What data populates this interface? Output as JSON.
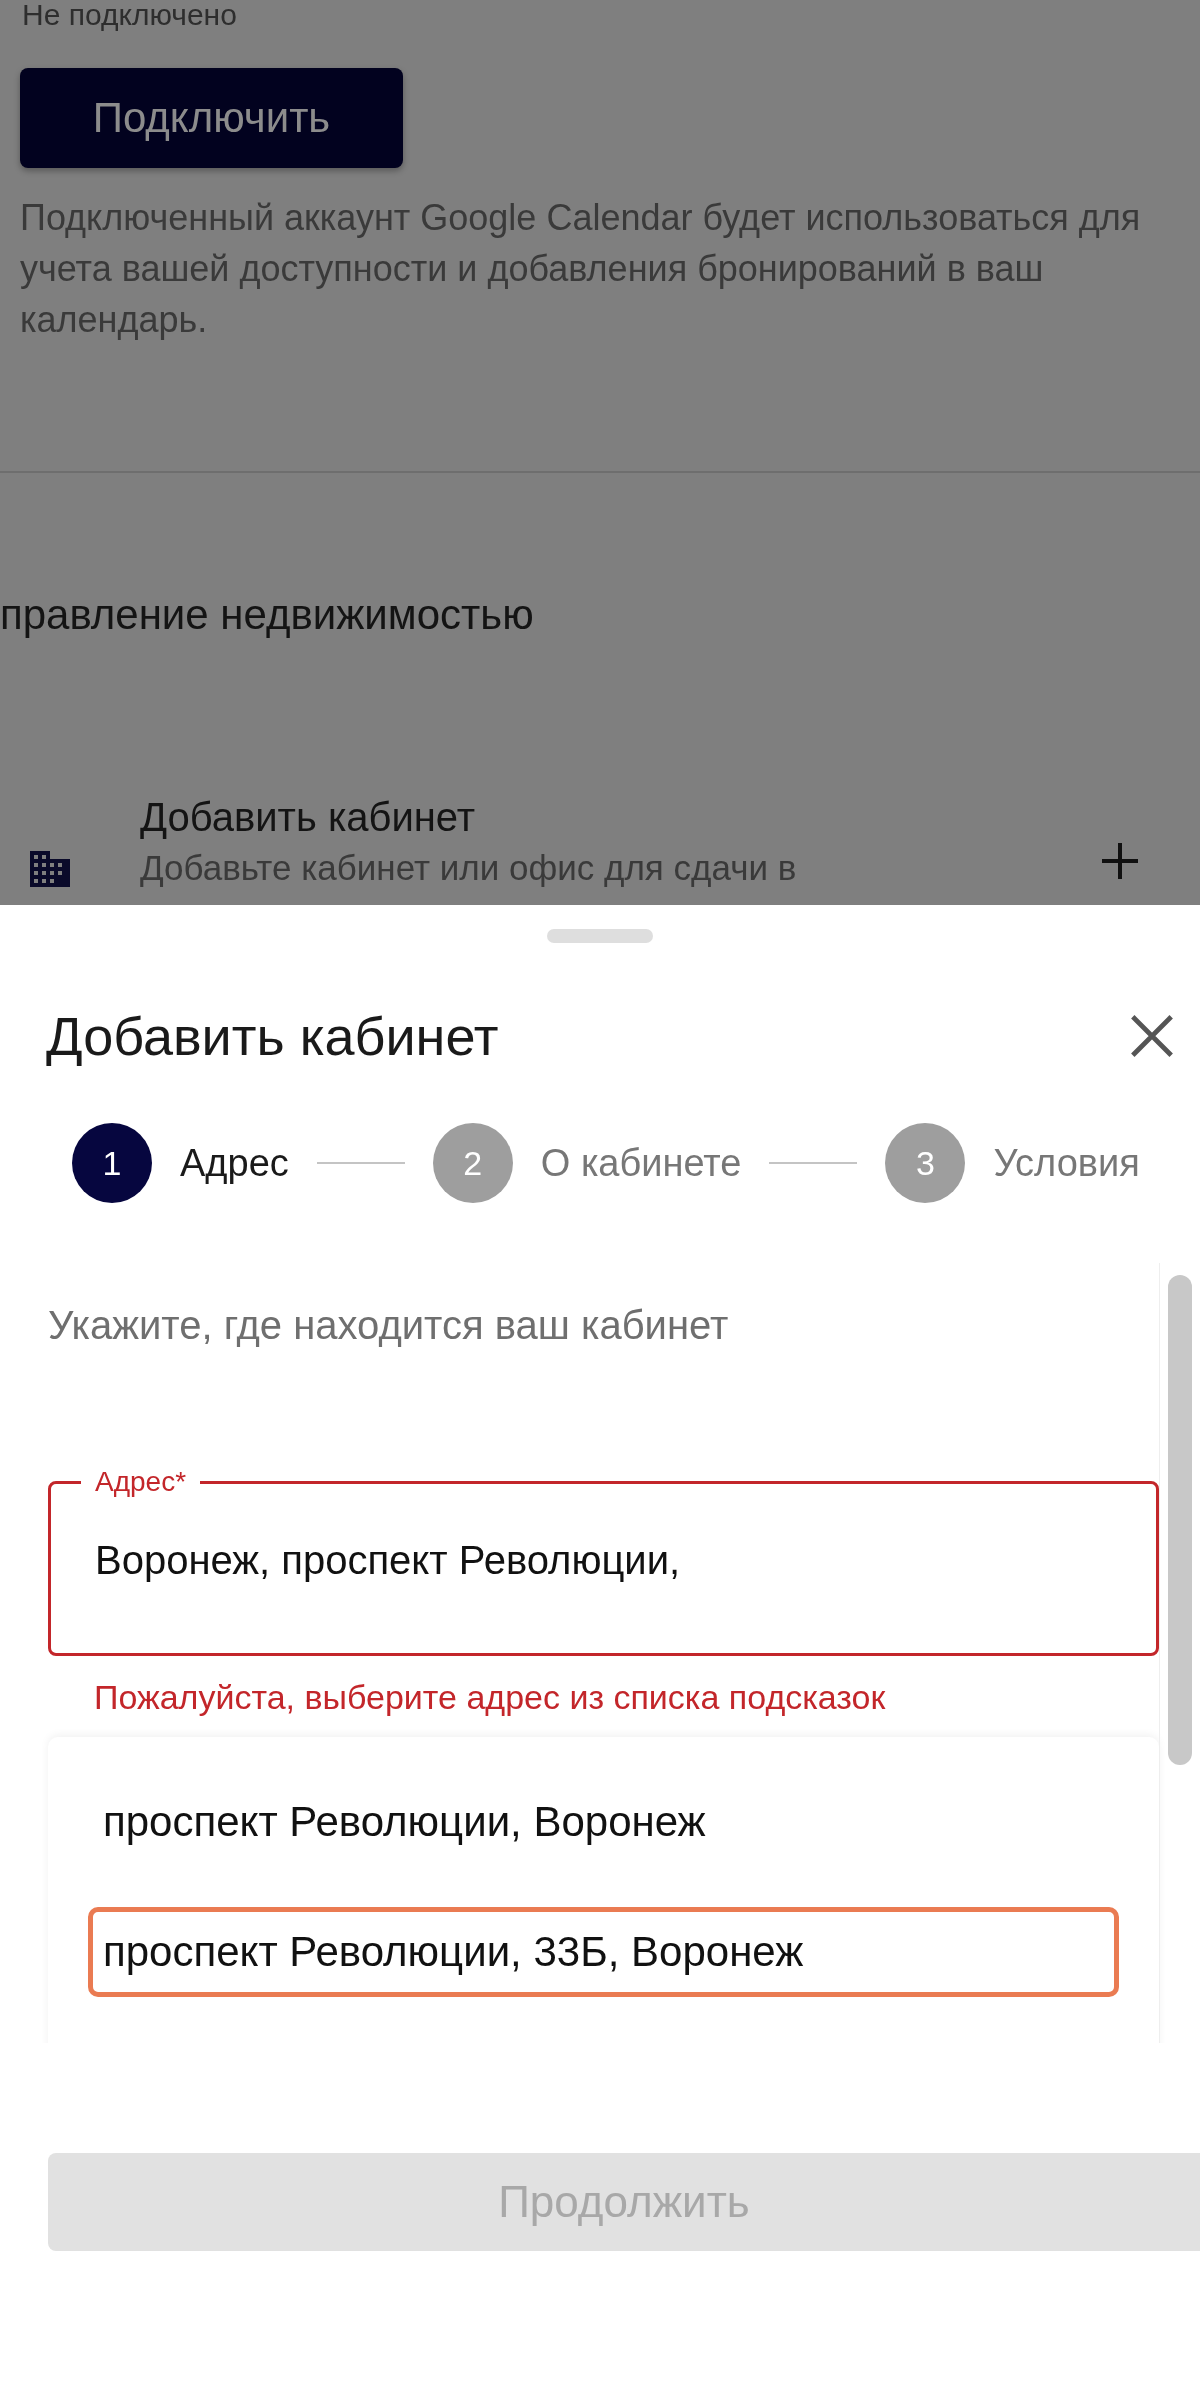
{
  "background": {
    "status": "Не подключено",
    "connect_button": "Подключить",
    "description": "Подключенный аккаунт Google Calendar будет использоваться для учета вашей доступности и добавления бронирований в ваш календарь.",
    "section_title": "правление недвижимостью",
    "add_item": {
      "title": "Добавить кабинет",
      "subtitle": "Добавьте кабинет или офис для сдачи в"
    }
  },
  "sheet": {
    "title": "Добавить кабинет",
    "steps": [
      {
        "number": "1",
        "label": "Адрес",
        "selected": true
      },
      {
        "number": "2",
        "label": "О кабинете",
        "selected": false
      },
      {
        "number": "3",
        "label": "Условия",
        "selected": false
      }
    ],
    "prompt": "Укажите, где находится ваш кабинет",
    "address_field": {
      "label": "Адрес*",
      "value": "Воронеж, проспект Революции,",
      "error": "Пожалуйста, выберите адрес из списка подсказок",
      "invalid": true
    },
    "suggestions": [
      {
        "text": "проспект Революции, Воронеж",
        "highlighted": false
      },
      {
        "text": "проспект Революции, 33Б, Воронеж",
        "highlighted": true
      }
    ],
    "continue_button": {
      "label": "Продолжить",
      "disabled": true
    }
  }
}
